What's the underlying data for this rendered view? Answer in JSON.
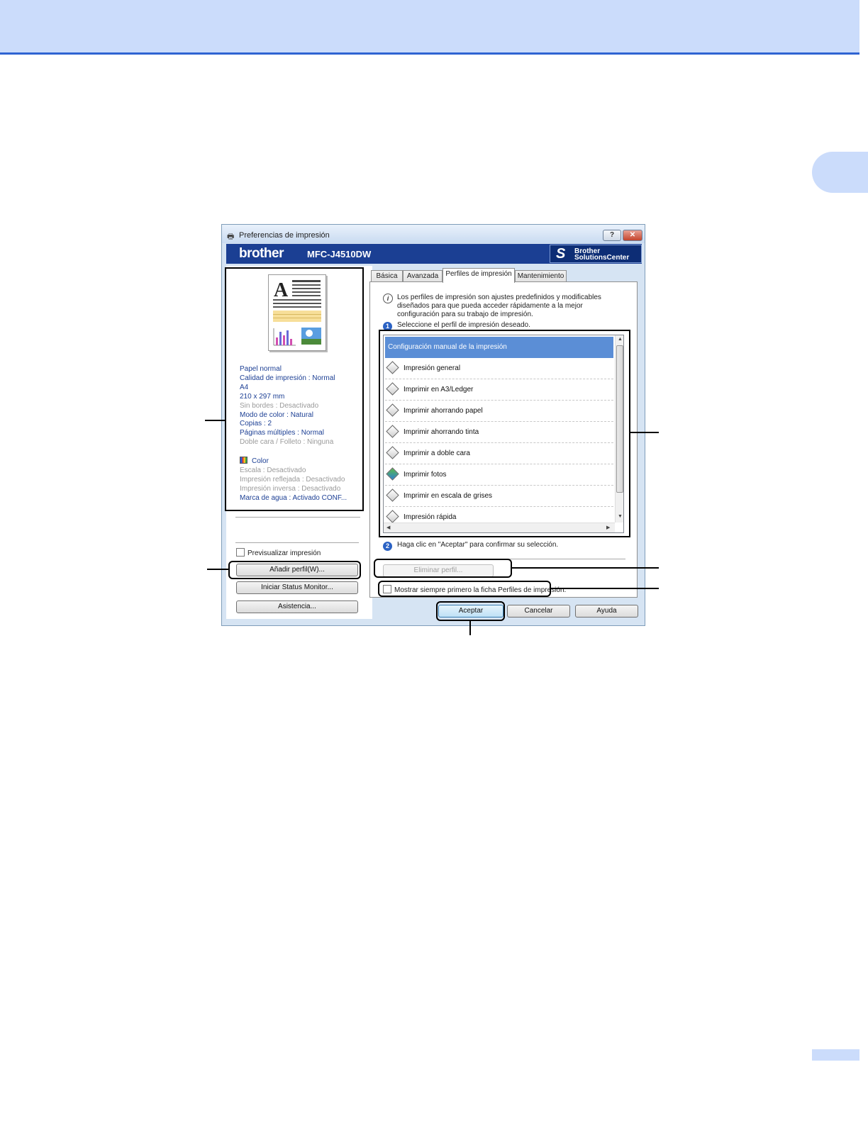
{
  "window": {
    "title": "Preferencias de impresión",
    "help_label": "?",
    "close_label": "✕"
  },
  "brand": {
    "logo": "brother",
    "model": "MFC-J4510DW",
    "solutions_line1": "Brother",
    "solutions_line2": "SolutionsCenter"
  },
  "settings": [
    {
      "text": "Papel normal",
      "active": true
    },
    {
      "text": "Calidad de impresión : Normal",
      "active": true
    },
    {
      "text": "A4",
      "active": true
    },
    {
      "text": "210 x 297 mm",
      "active": true
    },
    {
      "text": "Sin bordes : Desactivado",
      "active": false
    },
    {
      "text": "Modo de color : Natural",
      "active": true
    },
    {
      "text": "Copias : 2",
      "active": true
    },
    {
      "text": "Páginas múltiples : Normal",
      "active": true
    },
    {
      "text": "Doble cara / Folleto : Ninguna",
      "active": false
    }
  ],
  "color_label": "Color",
  "settings2": [
    {
      "text": "Escala : Desactivado",
      "active": false
    },
    {
      "text": "Impresión reflejada : Desactivado",
      "active": false
    },
    {
      "text": "Impresión inversa : Desactivado",
      "active": false
    },
    {
      "text": "Marca de agua : Activado  CONF...",
      "active": true
    }
  ],
  "left": {
    "preview_checkbox": "Previsualizar impresión",
    "add_profile": "Añadir perfil(W)...",
    "status_monitor": "Iniciar Status Monitor...",
    "support": "Asistencia..."
  },
  "tabs": [
    "Básica",
    "Avanzada",
    "Perfiles de impresión",
    "Mantenimiento"
  ],
  "info_text": "Los perfiles de impresión son ajustes predefinidos y modificables diseñados para que pueda acceder rápidamente a la mejor configuración para su trabajo de impresión.",
  "step1": {
    "num": "1",
    "text": "Seleccione el perfil de impresión deseado."
  },
  "profiles": [
    "Configuración manual de la impresión",
    "Impresión general",
    "Imprimir en A3/Ledger",
    "Imprimir ahorrando papel",
    "Imprimir ahorrando tinta",
    "Imprimir a doble cara",
    "Imprimir fotos",
    "Imprimir en escala de grises",
    "Impresión rápida"
  ],
  "step2": {
    "num": "2",
    "text": "Haga clic en \"Aceptar\" para confirmar su selección."
  },
  "delete_profile": "Eliminar perfil...",
  "always_show": "Mostrar siempre primero la ficha Perfiles de impresión.",
  "bottom_buttons": {
    "ok": "Aceptar",
    "cancel": "Cancelar",
    "help": "Ayuda"
  },
  "colors": {
    "brand_bar": "#1b3f93",
    "selection": "#5b8ed6",
    "header_band": "#cbdcfb",
    "accent_line": "#2f64d2"
  }
}
